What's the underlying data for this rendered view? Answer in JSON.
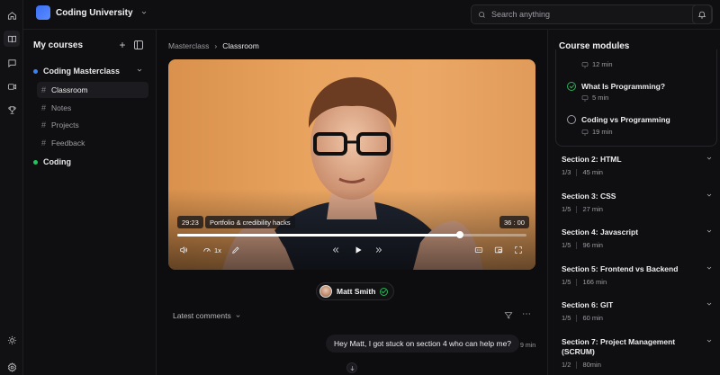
{
  "app": {
    "name": "Coding University",
    "brand_color": "#3b6ff5"
  },
  "search": {
    "placeholder": "Search anything"
  },
  "rail": {
    "icons": [
      "home-icon",
      "book-icon",
      "chat-icon",
      "video-icon",
      "trophy-icon",
      "sun-icon",
      "settings-icon"
    ]
  },
  "sidebar": {
    "title": "My courses",
    "courses": [
      {
        "label": "Coding Masterclass",
        "dot_color": "#3b82f6",
        "expanded": true,
        "items": [
          {
            "label": "Classroom",
            "active": true
          },
          {
            "label": "Notes",
            "active": false
          },
          {
            "label": "Projects",
            "active": false
          },
          {
            "label": "Feedback",
            "active": false
          }
        ]
      },
      {
        "label": "Coding",
        "dot_color": "#22c55e",
        "expanded": false
      }
    ]
  },
  "breadcrumb": {
    "parent": "Masterclass",
    "current": "Classroom"
  },
  "video": {
    "elapsed": "29:23",
    "chapter": "Portfolio & credibility hacks",
    "duration": "36 : 00",
    "progress": 0.81,
    "speed": "1x"
  },
  "author": {
    "name": "Matt Smith"
  },
  "comments": {
    "sort_label": "Latest comments",
    "items": [
      {
        "text": "Hey Matt, I got stuck on section 4 who can help me?",
        "time": "9 min"
      }
    ]
  },
  "modules": {
    "title": "Course modules",
    "current_lessons": [
      {
        "title": "",
        "duration": "12 min",
        "status": "none"
      },
      {
        "title": "What Is Programming?",
        "duration": "5 min",
        "status": "done"
      },
      {
        "title": "Coding vs Programming",
        "duration": "19 min",
        "status": "todo"
      }
    ],
    "sections": [
      {
        "title": "Section 2: HTML",
        "progress": "1/3",
        "duration": "45 min"
      },
      {
        "title": "Section 3: CSS",
        "progress": "1/5",
        "duration": "27 min"
      },
      {
        "title": "Section 4: Javascript",
        "progress": "1/5",
        "duration": "96 min"
      },
      {
        "title": "Section 5: Frontend vs Backend",
        "progress": "1/5",
        "duration": "166 min"
      },
      {
        "title": "Section 6: GIT",
        "progress": "1/5",
        "duration": "60 min"
      },
      {
        "title": "Section 7: Project Management (SCRUM)",
        "progress": "1/2",
        "duration": "80min"
      }
    ]
  }
}
